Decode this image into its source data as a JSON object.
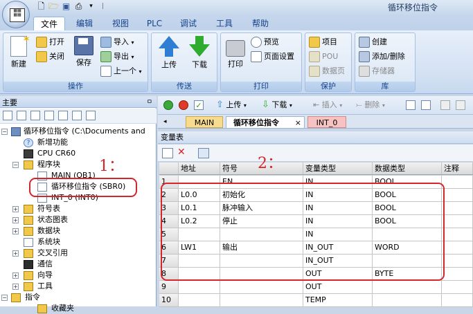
{
  "window": {
    "title": "循环移位指令"
  },
  "ribbon_tabs": [
    "文件",
    "编辑",
    "视图",
    "PLC",
    "调试",
    "工具",
    "帮助"
  ],
  "ribbon": {
    "groups": {
      "operation": "操作",
      "transfer": "传送",
      "print": "打印",
      "protect": "保护",
      "library": "库"
    },
    "buttons": {
      "new": "新建",
      "open": "打开",
      "close": "关闭",
      "save": "保存",
      "import": "导入",
      "export": "导出",
      "previous": "上一个",
      "upload": "上传",
      "download": "下载",
      "print": "打印",
      "preview": "预览",
      "page_setup": "页面设置",
      "project": "项目",
      "pou": "POU",
      "data_page": "数据页",
      "create": "创建",
      "add_remove": "添加/删除",
      "memory": "存储器"
    }
  },
  "left_panel": {
    "title": "主要",
    "pin": "ㅁ",
    "tree": {
      "root": "循环移位指令 (C:\\Documents and",
      "new_features": "新增功能",
      "cpu": "CPU CR60",
      "program_block": "程序块",
      "main": "MAIN (OB1)",
      "sbr0": "循环移位指令 (SBR0)",
      "int0": "INT_0 (INT0)",
      "symbol_table": "符号表",
      "status_chart": "状态图表",
      "data_block": "数据块",
      "system_block": "系统块",
      "cross_reference": "交叉引用",
      "communication": "通信",
      "wizard": "向导",
      "tools": "工具",
      "instructions": "指令",
      "favorites": "收藏夹"
    }
  },
  "editor_toolbar": {
    "upload": "上传",
    "download": "下载",
    "insert": "插入",
    "delete": "删除"
  },
  "editor_tabs": [
    "MAIN",
    "循环移位指令",
    "INT_0"
  ],
  "editor_tab_close": "×",
  "variable_table": {
    "title": "变量表",
    "columns": [
      "",
      "地址",
      "符号",
      "变量类型",
      "数据类型",
      "注释"
    ],
    "rows": [
      [
        "1",
        "",
        "EN",
        "IN",
        "BOOL",
        ""
      ],
      [
        "2",
        "L0.0",
        "初始化",
        "IN",
        "BOOL",
        ""
      ],
      [
        "3",
        "L0.1",
        "脉冲输入",
        "IN",
        "BOOL",
        ""
      ],
      [
        "4",
        "L0.2",
        "停止",
        "IN",
        "BOOL",
        ""
      ],
      [
        "5",
        "",
        "",
        "IN",
        "",
        ""
      ],
      [
        "6",
        "LW1",
        "输出",
        "IN_OUT",
        "WORD",
        ""
      ],
      [
        "7",
        "",
        "",
        "IN_OUT",
        "",
        ""
      ],
      [
        "8",
        "",
        "",
        "OUT",
        "BYTE",
        ""
      ],
      [
        "9",
        "",
        "",
        "OUT",
        "",
        ""
      ],
      [
        "10",
        "",
        "",
        "TEMP",
        "",
        ""
      ]
    ]
  },
  "annotations": {
    "one": "1：",
    "two": "2："
  },
  "colors": {
    "highlight": "#d6242b",
    "ribbon_text": "#15428b"
  }
}
